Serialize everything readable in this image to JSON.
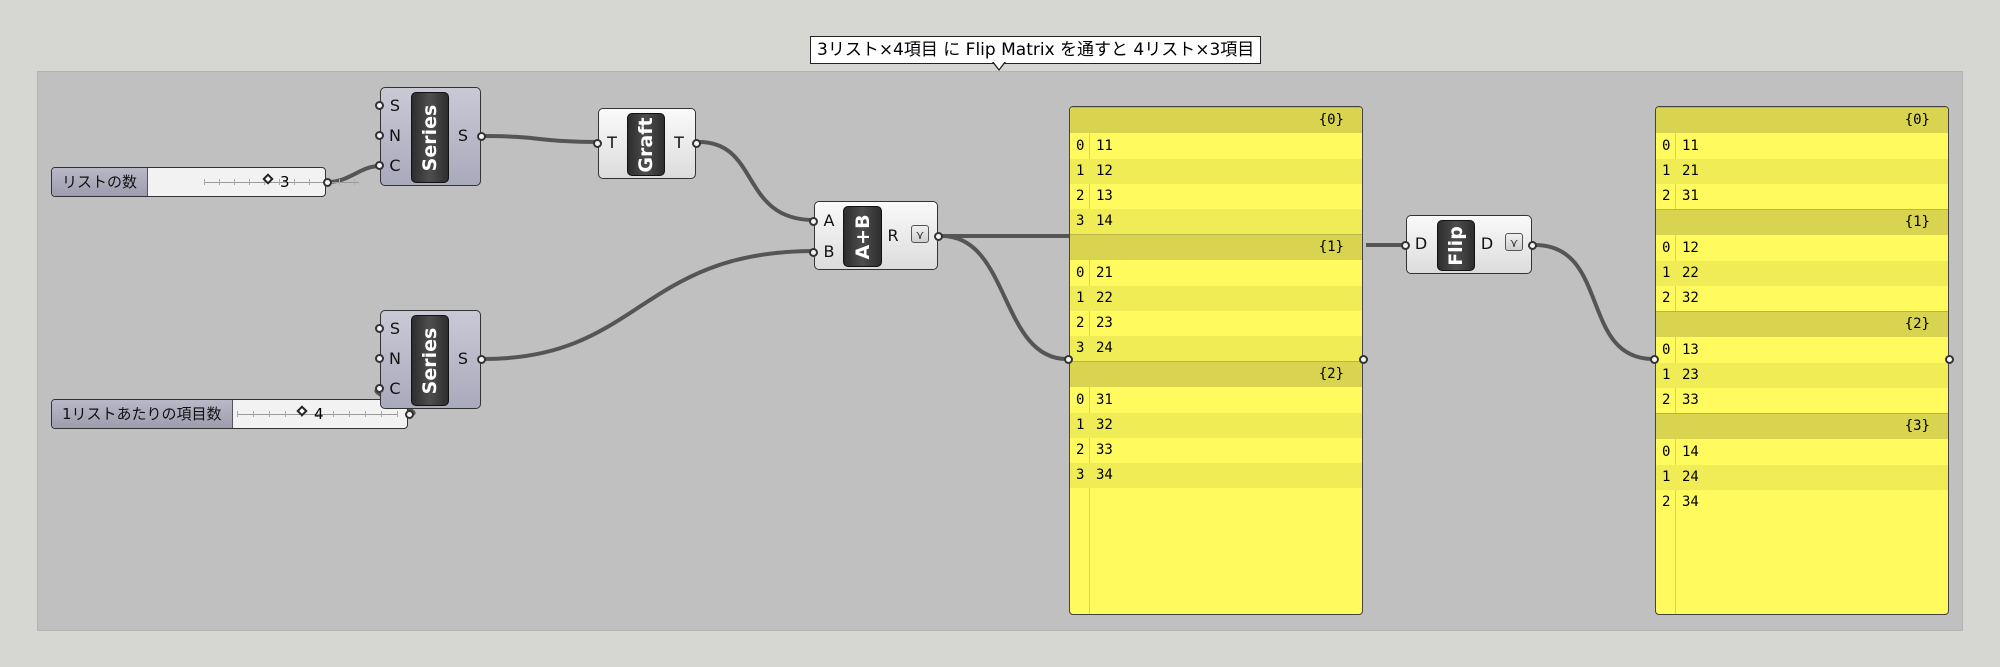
{
  "group_title": "3リスト×4項目 に Flip Matrix を通すと 4リスト×3項目",
  "colors": {
    "canvas": "#d6d7d2",
    "group": "#c0c0c0",
    "panel": "#fffa5e",
    "wire": "#555555"
  },
  "sliders": [
    {
      "label": "リストの数",
      "value": "3"
    },
    {
      "label": "1リストあたりの項目数",
      "value": "4"
    }
  ],
  "series1": {
    "nickname": "Series",
    "inputs": [
      "S",
      "N",
      "C"
    ],
    "output": "S"
  },
  "series2": {
    "nickname": "Series",
    "inputs": [
      "S",
      "N",
      "C"
    ],
    "output": "S"
  },
  "graft": {
    "nickname": "Graft",
    "input": "T",
    "output": "T"
  },
  "addition": {
    "nickname": "A+B",
    "inputs": [
      "A",
      "B"
    ],
    "output": "R",
    "flag_icon": "graft-flag-icon"
  },
  "flip": {
    "nickname": "Flip",
    "input": "D",
    "output": "D",
    "flag_icon": "graft-flag-icon"
  },
  "panel1": {
    "branches": [
      {
        "path": "{0}",
        "items": [
          "11",
          "12",
          "13",
          "14"
        ]
      },
      {
        "path": "{1}",
        "items": [
          "21",
          "22",
          "23",
          "24"
        ]
      },
      {
        "path": "{2}",
        "items": [
          "31",
          "32",
          "33",
          "34"
        ]
      }
    ]
  },
  "panel2": {
    "branches": [
      {
        "path": "{0}",
        "items": [
          "11",
          "21",
          "31"
        ]
      },
      {
        "path": "{1}",
        "items": [
          "12",
          "22",
          "32"
        ]
      },
      {
        "path": "{2}",
        "items": [
          "13",
          "23",
          "33"
        ]
      },
      {
        "path": "{3}",
        "items": [
          "14",
          "24",
          "34"
        ]
      }
    ]
  }
}
